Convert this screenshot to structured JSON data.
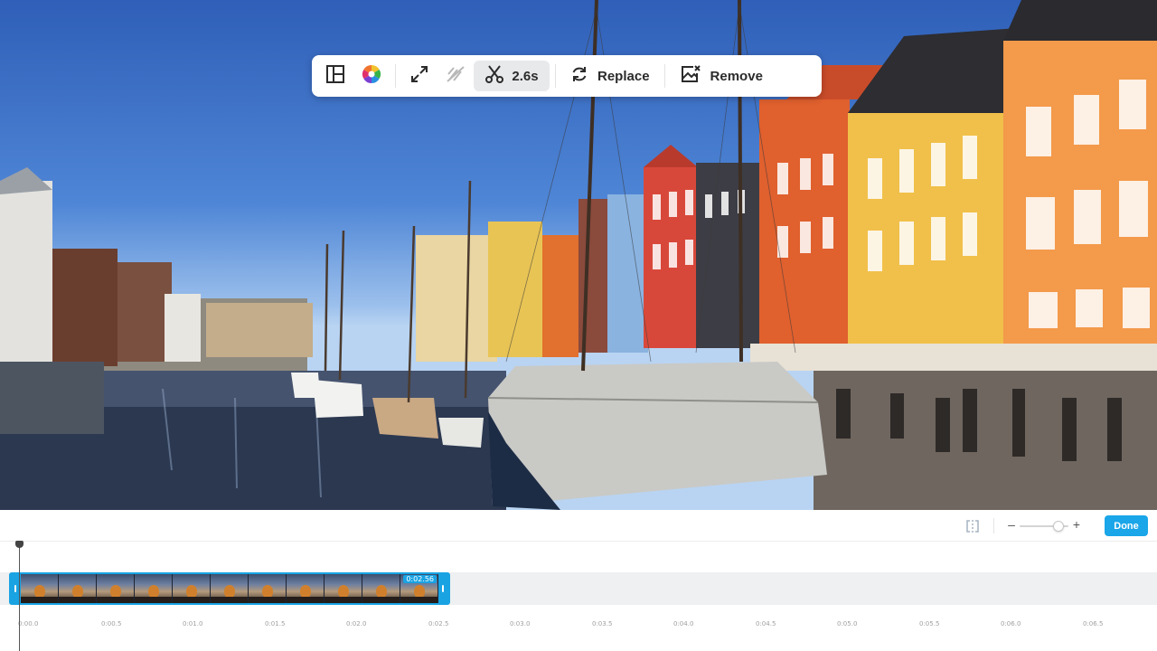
{
  "preview": {
    "scene": "harbor-canal-photo"
  },
  "toolbar": {
    "trim_duration": "2.6s",
    "replace_label": "Replace",
    "remove_label": "Remove"
  },
  "timeline": {
    "done_label": "Done",
    "clip_duration": "0:02.56",
    "zoom_level": 0.8,
    "ruler_ticks": [
      "0:00.0",
      "0:00.5",
      "0:01.0",
      "0:01.5",
      "0:02.0",
      "0:02.5",
      "0:03.0",
      "0:03.5",
      "0:04.0",
      "0:04.5",
      "0:05.0",
      "0:05.5",
      "0:06.0",
      "0:06.5"
    ]
  },
  "colors": {
    "accent": "#19a3e3",
    "done_button": "#1aa6e8",
    "toolbar_active_bg": "#e8e9eb"
  }
}
